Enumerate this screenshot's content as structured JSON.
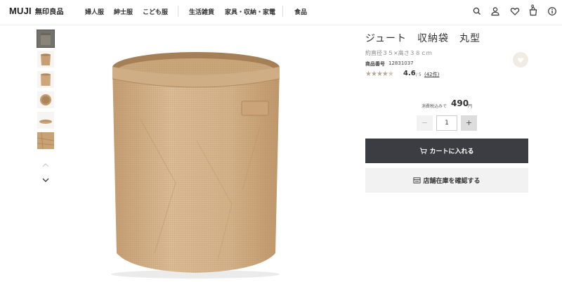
{
  "header": {
    "logo_main": "MUJI",
    "logo_jp": "無印良品",
    "nav": [
      "婦人服",
      "紳士服",
      "こども服",
      "生活雑貨",
      "家具・収納・家電",
      "食品"
    ],
    "cart_count": "0",
    "icons": [
      "search-icon",
      "user-icon",
      "heart-icon",
      "cart-icon",
      "info-icon"
    ]
  },
  "gallery": {
    "thumb_count": 6,
    "active_index": 0,
    "main_image": "jute-storage-bag-round"
  },
  "product": {
    "title": "ジュート　収納袋　丸型",
    "size": "約直径３５×高さ３８ｃｍ",
    "code_label": "商品番号",
    "code": "12831037",
    "rating": "4.6",
    "rating_max": "/ 5",
    "rating_value": 4.6,
    "review_count": "(42件)",
    "price_label": "消費税込みで",
    "price": "490",
    "price_unit": "円",
    "quantity": "1",
    "minus_label": "−",
    "plus_label": "+",
    "cart_button": "カートに入れる",
    "store_button": "店舗在庫を確認する"
  },
  "colors": {
    "dark": "#3c3c43",
    "jute": "#c8a57a",
    "star": "#b4aa98"
  }
}
